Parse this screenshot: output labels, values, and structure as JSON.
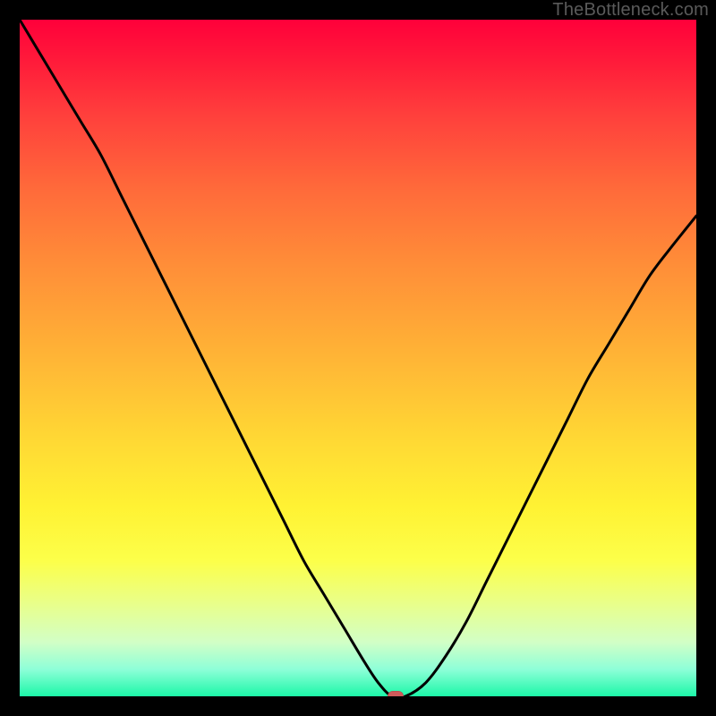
{
  "watermark": "TheBottleneck.com",
  "colors": {
    "frame": "#000000",
    "curve": "#000000",
    "marker": "#cf5a5a"
  },
  "chart_data": {
    "type": "line",
    "title": "",
    "xlabel": "",
    "ylabel": "",
    "xlim": [
      0,
      100
    ],
    "ylim": [
      0,
      100
    ],
    "grid": false,
    "legend": false,
    "series": [
      {
        "name": "bottleneck-curve",
        "x": [
          0,
          3,
          6,
          9,
          12,
          15,
          18,
          21,
          24,
          27,
          30,
          33,
          36,
          39,
          42,
          45,
          48,
          51,
          53,
          55,
          57,
          60,
          63,
          66,
          69,
          72,
          75,
          78,
          81,
          84,
          87,
          90,
          93,
          96,
          100
        ],
        "values": [
          100,
          95,
          90,
          85,
          80,
          74,
          68,
          62,
          56,
          50,
          44,
          38,
          32,
          26,
          20,
          15,
          10,
          5,
          2,
          0,
          0,
          2,
          6,
          11,
          17,
          23,
          29,
          35,
          41,
          47,
          52,
          57,
          62,
          66,
          71
        ]
      }
    ],
    "annotations": [
      {
        "name": "minimum-marker",
        "x": 55.5,
        "y": 0,
        "color": "#cf5a5a"
      }
    ]
  }
}
